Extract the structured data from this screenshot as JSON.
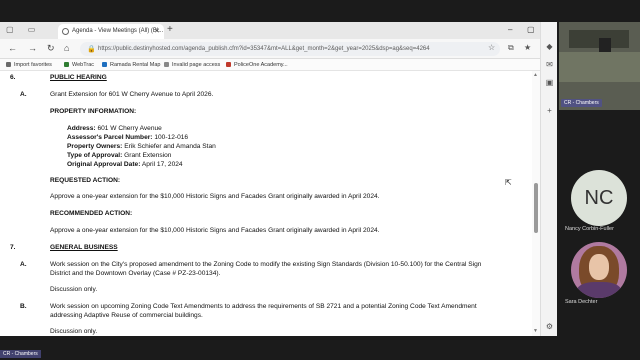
{
  "browser": {
    "tab_title": "Agenda - View Meetings (All) (Bl...",
    "url": "https://public.destinyhosted.com/agenda_publish.cfm?id=35347&mt=ALL&get_month=2&get_year=2025&dsp=ag&seq=4264"
  },
  "favorites": [
    {
      "label": "Import favorites",
      "color": "#6b6b6b"
    },
    {
      "label": "WebTrac",
      "color": "#2f7d32"
    },
    {
      "label": "Ramada Rental Map",
      "color": "#1f6fbf"
    },
    {
      "label": "Invalid page access",
      "color": "#888888"
    },
    {
      "label": "PoliceOne Academy...",
      "color": "#c0392b"
    }
  ],
  "agenda": {
    "item6_num": "6.",
    "item6_title": "PUBLIC HEARING",
    "a_label": "A.",
    "a_link": "Grant Extension for 601 W Cherry Avenue to April 2026.",
    "prop_heading": "PROPERTY INFORMATION:",
    "prop_rows": [
      {
        "label": "Address:",
        "value": "601 W Cherry Avenue"
      },
      {
        "label": "Assessor's Parcel Number:",
        "value": "100-12-016"
      },
      {
        "label": "Property Owners:",
        "value": "Erik Schiefer and Amanda Stan"
      },
      {
        "label": "Type of Approval:",
        "value": "Grant Extension"
      },
      {
        "label": "Original Approval Date:",
        "value": "April 17, 2024"
      }
    ],
    "requested_heading": "REQUESTED ACTION:",
    "requested_text": "Approve a one-year extension for the $10,000 Historic Signs and Facades Grant originally awarded in April 2024.",
    "recommended_heading": "RECOMMENDED ACTION:",
    "recommended_text": "Approve a one-year extension for the $10,000 Historic Signs and Facades Grant originally awarded in April 2024.",
    "item7_num": "7.",
    "item7_title": "GENERAL BUSINESS",
    "b7a_label": "A.",
    "b7a_line1": "Work session on the City's proposed amendment to the Zoning Code to modify the existing Sign Standards (Division 10-50.100) for the Central Sign",
    "b7a_line2": "District and the Downtown Overlay (Case # PZ-23-00134).",
    "b7a_note": "Discussion only.",
    "b7b_label": "B.",
    "b7b_line1": "Work session on upcoming Zoning Code Text Amendments to address the requirements of SB 2721 and a potential Zoning Code Text Amendment",
    "b7b_line2": "addressing Adaptive Reuse of commercial buildings.",
    "b7b_note": "Discussion only."
  },
  "participants": {
    "top_label": "CR - Chambers",
    "nc_initials": "NC",
    "nc_name": "Nancy Corbin-Fuller",
    "sd_name": "Sara Dechter",
    "bottom_label": "CR - Chambers"
  }
}
